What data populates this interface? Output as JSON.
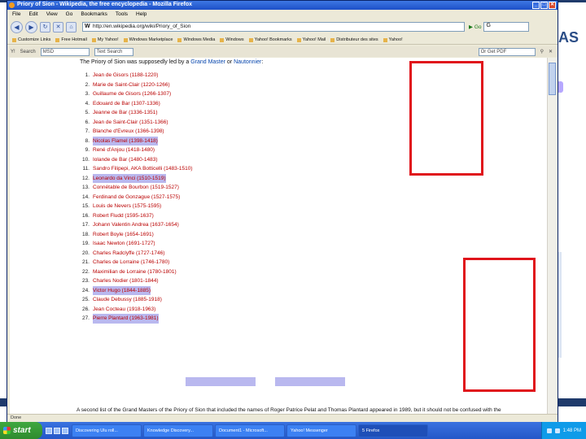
{
  "window": {
    "title": "Priory of Sion - Wikipedia, the free encyclopedia - Mozilla Firefox",
    "min": "_",
    "max": "□",
    "close": "✕"
  },
  "menu": [
    "File",
    "Edit",
    "View",
    "Go",
    "Bookmarks",
    "Tools",
    "Help"
  ],
  "nav": {
    "url": "http://en.wikipedia.org/wiki/Priory_of_Sion",
    "go_label": "Go",
    "search_engine_letter": "G"
  },
  "bookmarks": [
    "Customize Links",
    "Free Hotmail",
    "My Yahoo!",
    "Windows Marketplace",
    "Windows Media",
    "Windows",
    "Yahoo! Bookmarks",
    "Yahoo! Mail",
    "Distributeur des sites",
    "Yahoo!"
  ],
  "toolbar2": {
    "y_label": "Y!",
    "search_label": "Search",
    "search_value": "MSD",
    "text_search": "Text Search",
    "pdf_label": "Or Get PDF"
  },
  "content": {
    "intro_prefix": "The Priory of Sion was supposedly led by a ",
    "intro_link1": "Grand Master",
    "intro_mid": " or ",
    "intro_link2": "Nautonnier",
    "intro_suffix": ":",
    "grand_masters": [
      {
        "num": "1.",
        "name": "Jean de Gisors (1188-1220)",
        "hl": false
      },
      {
        "num": "2.",
        "name": "Marie de Saint-Clair (1220-1266)",
        "hl": false
      },
      {
        "num": "3.",
        "name": "Guillaume de Gisors (1266-1307)",
        "hl": false
      },
      {
        "num": "4.",
        "name": "Edouard de Bar (1307-1336)",
        "hl": false
      },
      {
        "num": "5.",
        "name": "Jeanne de Bar (1336-1351)",
        "hl": false
      },
      {
        "num": "6.",
        "name": "Jean de Saint-Clair (1351-1366)",
        "hl": false
      },
      {
        "num": "7.",
        "name": "Blanche d'Evreux (1366-1398)",
        "hl": false
      },
      {
        "num": "8.",
        "name": "Nicolas Flamel (1398-1418)",
        "hl": true
      },
      {
        "num": "9.",
        "name": "René d'Anjou (1418-1480)",
        "hl": false
      },
      {
        "num": "10.",
        "name": "Iolande de Bar (1480-1483)",
        "hl": false
      },
      {
        "num": "11.",
        "name": "Sandro Filipepi, AKA Botticelli (1483-1510)",
        "hl": false
      },
      {
        "num": "12.",
        "name": "Leonardo da Vinci (1510-1519)",
        "hl": true
      },
      {
        "num": "13.",
        "name": "Connétable de Bourbon (1519-1527)",
        "hl": false
      },
      {
        "num": "14.",
        "name": "Ferdinand de Gonzague (1527-1575)",
        "hl": false
      },
      {
        "num": "15.",
        "name": "Louis de Nevers (1575-1595)",
        "hl": false
      },
      {
        "num": "16.",
        "name": "Robert Fludd (1595-1637)",
        "hl": false
      },
      {
        "num": "17.",
        "name": "Johann Valentin Andrea (1637-1654)",
        "hl": false
      },
      {
        "num": "18.",
        "name": "Robert Boyle (1654-1691)",
        "hl": false
      },
      {
        "num": "19.",
        "name": "Isaac Newton (1691-1727)",
        "hl": false
      },
      {
        "num": "20.",
        "name": "Charles Radclyffe (1727-1746)",
        "hl": false
      },
      {
        "num": "21.",
        "name": "Charles de Lorraine (1746-1780)",
        "hl": false
      },
      {
        "num": "22.",
        "name": "Maximilian de Lorraine (1780-1801)",
        "hl": false
      },
      {
        "num": "23.",
        "name": "Charles Nodier (1801-1844)",
        "hl": false
      },
      {
        "num": "24.",
        "name": "Victor Hugo (1844-1885)",
        "hl": true
      },
      {
        "num": "25.",
        "name": "Claude Debussy (1885-1918)",
        "hl": false
      },
      {
        "num": "26.",
        "name": "Jean Cocteau (1918-1963)",
        "hl": false
      },
      {
        "num": "27.",
        "name": "Pierre Plantard (1963-1981)",
        "hl": true
      }
    ],
    "footer": "A second list of the Grand Masters of the Priory of Sion that included the names of Roger Patrice Pelat and Thomas Plantard appeared in 1989, but it should not be confused with the"
  },
  "status": "Done",
  "taskbar": {
    "start": "start",
    "tasks": [
      "Discovering Ulu roll...",
      "Knowledge Discovery...",
      "Document1 - Microsoft...",
      "Yahoo! Messenger",
      "5 Firefox"
    ],
    "clock": "1:48 PM"
  },
  "slide": {
    "corner_text": "AS"
  },
  "colors": {
    "annotation_red": "#e0141b",
    "highlight": "#b9b8ef",
    "link": "#0645ad",
    "redlink": "#ba0000"
  }
}
